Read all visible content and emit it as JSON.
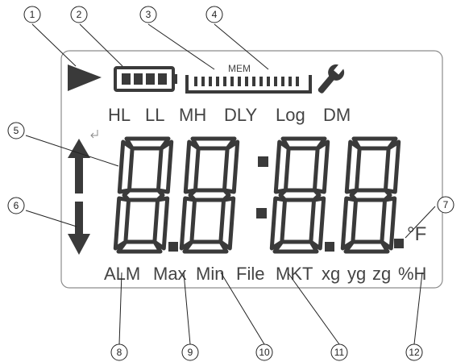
{
  "callouts": [
    "1",
    "2",
    "3",
    "4",
    "5",
    "6",
    "7",
    "8",
    "9",
    "10",
    "11",
    "12"
  ],
  "mem_label": "MEM",
  "mode_labels": [
    "HL",
    "LL",
    "MH",
    "DLY",
    "Log",
    "DM"
  ],
  "bottom_labels": [
    "ALM",
    "Max",
    "Min",
    "File",
    "MKT",
    "xg",
    "yg",
    "zg",
    "%H"
  ],
  "unit_label": "°F",
  "colors": {
    "segment": "#3a3a3a",
    "display_border": "#8c8c8c",
    "text": "#444444"
  },
  "icons": [
    "play-icon",
    "battery-icon",
    "memory-bar-icon",
    "wrench-icon",
    "up-arrow-icon",
    "down-arrow-icon",
    "return-icon"
  ]
}
